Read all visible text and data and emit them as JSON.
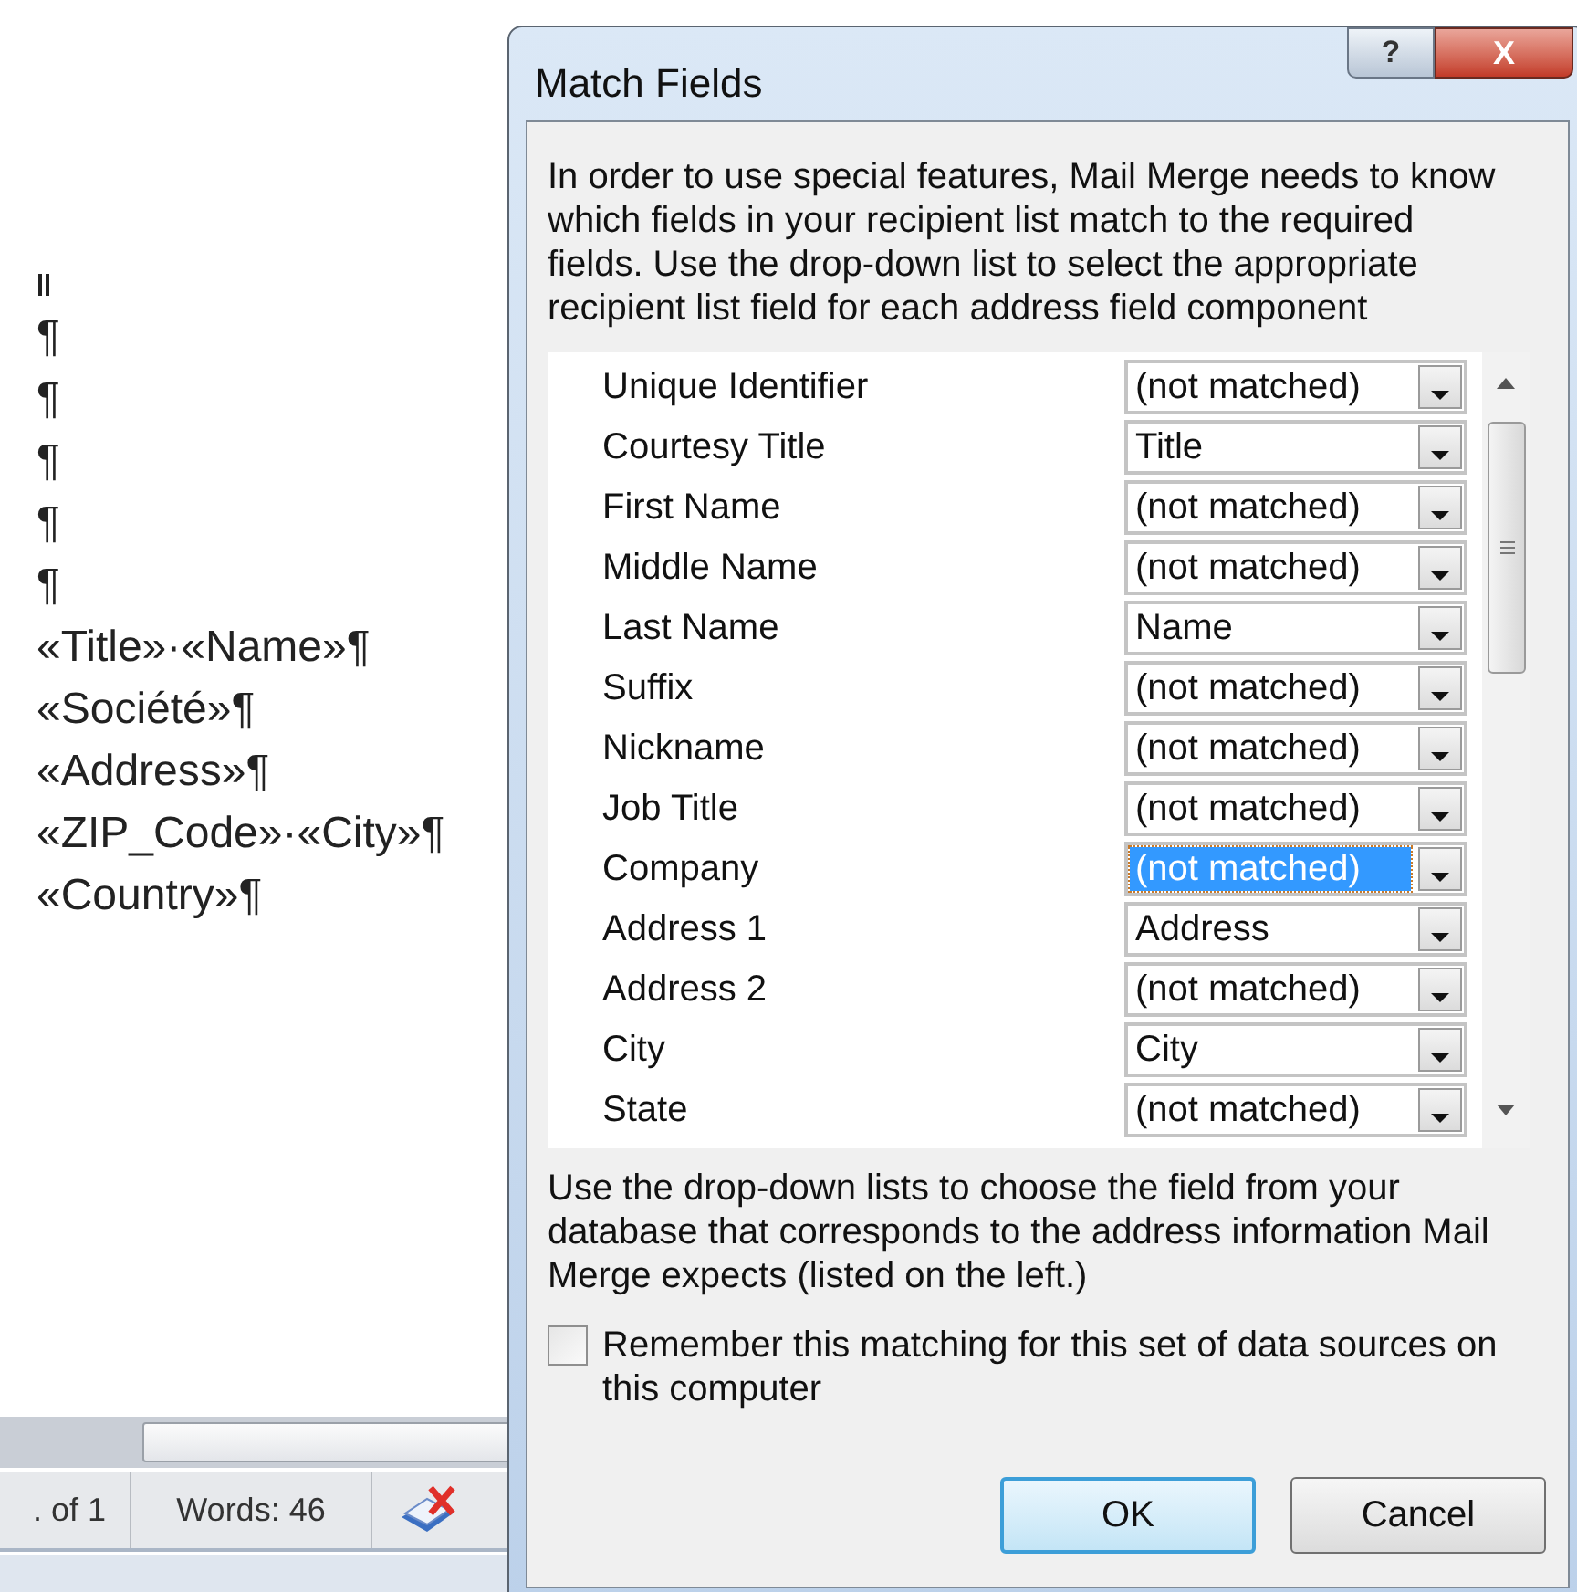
{
  "document": {
    "lines": [
      "¶",
      "¶",
      "¶",
      "¶",
      "¶",
      "«Title»·«Name»¶",
      "«Société»¶",
      "«Address»¶",
      "«ZIP_Code»·«City»¶",
      "«Country»¶"
    ]
  },
  "status_bar": {
    "page": ". of 1",
    "words": "Words: 46"
  },
  "dialog": {
    "title": "Match Fields",
    "help": "?",
    "close": "X",
    "intro": "In order to use special features, Mail Merge needs to know which fields in your recipient list match to the required fields.  Use the drop-down list to select the appropriate recipient list field for each address field component",
    "fields": [
      {
        "label": "Unique Identifier",
        "value": "(not matched)",
        "selected": false
      },
      {
        "label": "Courtesy Title",
        "value": "Title",
        "selected": false
      },
      {
        "label": "First Name",
        "value": "(not matched)",
        "selected": false
      },
      {
        "label": "Middle Name",
        "value": "(not matched)",
        "selected": false
      },
      {
        "label": "Last Name",
        "value": "Name",
        "selected": false
      },
      {
        "label": "Suffix",
        "value": "(not matched)",
        "selected": false
      },
      {
        "label": "Nickname",
        "value": "(not matched)",
        "selected": false
      },
      {
        "label": "Job Title",
        "value": "(not matched)",
        "selected": false
      },
      {
        "label": "Company",
        "value": "(not matched)",
        "selected": true
      },
      {
        "label": "Address 1",
        "value": "Address",
        "selected": false
      },
      {
        "label": "Address 2",
        "value": "(not matched)",
        "selected": false
      },
      {
        "label": "City",
        "value": "City",
        "selected": false
      },
      {
        "label": "State",
        "value": "(not matched)",
        "selected": false
      }
    ],
    "hint": "Use the drop-down lists to choose the field from your database that corresponds to the address information Mail Merge expects (listed on the left.)",
    "remember": {
      "label": "Remember this matching for this set of data sources on this computer",
      "checked": false
    },
    "buttons": [
      {
        "label": "OK",
        "default": true
      },
      {
        "label": "Cancel",
        "default": false
      }
    ]
  }
}
